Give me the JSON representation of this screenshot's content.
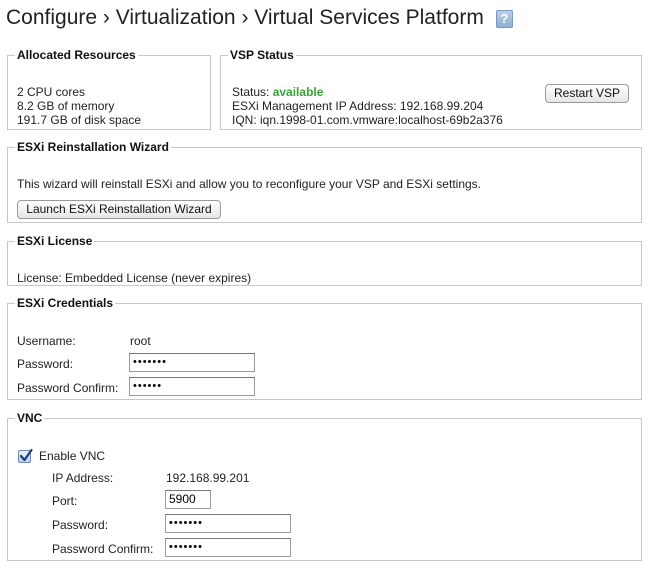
{
  "breadcrumb": {
    "configure": "Configure",
    "sep1": "›",
    "virtualization": "Virtualization",
    "sep2": "›",
    "vsp": "Virtual Services Platform",
    "help": "?"
  },
  "allocated": {
    "legend": "Allocated Resources",
    "cpu": "2 CPU cores",
    "memory": "8.2 GB of memory",
    "disk": "191.7 GB of disk space"
  },
  "vsp_status": {
    "legend": "VSP Status",
    "status_label": "Status:",
    "status_value": "available",
    "ip_text": "ESXi Management IP Address: 192.168.99.204",
    "iqn_text": "IQN: iqn.1998-01.com.vmware:localhost-69b2a376",
    "restart_label": "Restart VSP"
  },
  "wizard": {
    "legend": "ESXi Reinstallation Wizard",
    "description": "This wizard will reinstall ESXi and allow you to reconfigure your VSP and ESXi settings.",
    "launch_label": "Launch ESXi Reinstallation Wizard"
  },
  "license": {
    "legend": "ESXi License",
    "text": "License: Embedded License (never expires)"
  },
  "credentials": {
    "legend": "ESXi Credentials",
    "username_label": "Username:",
    "username_value": "root",
    "password_label": "Password:",
    "password_value": "•••••••",
    "confirm_label": "Password Confirm:",
    "confirm_value": "••••••"
  },
  "vnc": {
    "legend": "VNC",
    "enable_label": "Enable VNC",
    "enabled": true,
    "ip_label": "IP Address:",
    "ip_value": "192.168.99.201",
    "port_label": "Port:",
    "port_value": "5900",
    "password_label": "Password:",
    "password_value": "•••••••",
    "confirm_label": "Password Confirm:",
    "confirm_value": "•••••••"
  }
}
